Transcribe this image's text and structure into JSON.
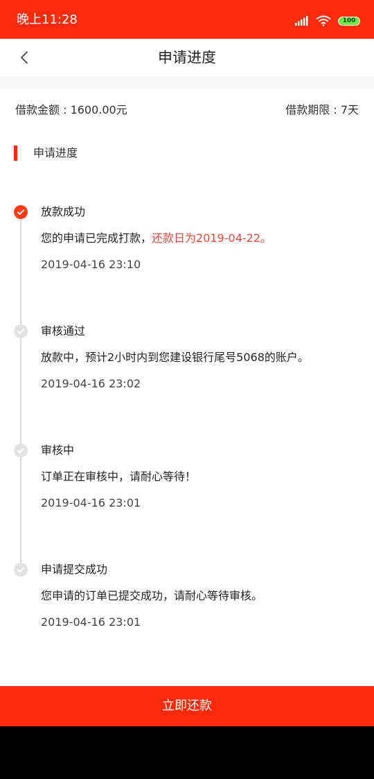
{
  "status_bar": {
    "time": "晚上11:28",
    "battery": "100"
  },
  "nav": {
    "title": "申请进度"
  },
  "loan": {
    "amount": "借款金额 : 1600.00元",
    "term": "借款期限 : 7天"
  },
  "section": {
    "title": "申请进度"
  },
  "steps": [
    {
      "title": "放款成功",
      "desc_plain": "您的申请已完成打款，",
      "desc_highlight": "还款日为2019-04-22。",
      "time": "2019-04-16 23:10"
    },
    {
      "title": "审核通过",
      "desc": "放款中，预计2小时内到您建设银行尾号5068的账户。",
      "time": "2019-04-16 23:02"
    },
    {
      "title": "审核中",
      "desc": "订单正在审核中，请耐心等待！",
      "time": "2019-04-16 23:01"
    },
    {
      "title": "申请提交成功",
      "desc": "您申请的订单已提交成功，请耐心等待审核。",
      "time": "2019-04-16 23:01"
    }
  ],
  "footer": {
    "repay_label": "立即还款"
  },
  "colors": {
    "brand": "#ff2a0c",
    "highlight": "#e8473c",
    "inactive_dot": "#e2e2e2"
  }
}
